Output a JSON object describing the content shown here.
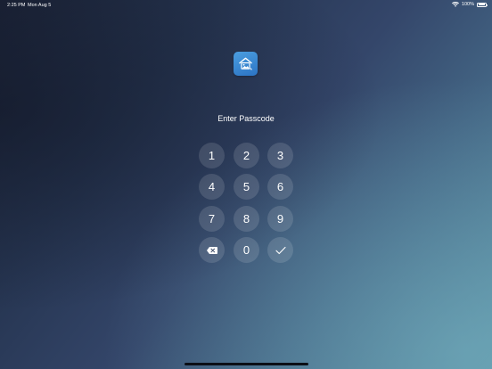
{
  "status_bar": {
    "time": "2:25 PM",
    "date": "Mon Aug 5",
    "battery_text": "100%",
    "wifi_icon": "wifi-icon",
    "battery_icon": "battery-icon",
    "battery_level": 1.0
  },
  "app": {
    "logo_icon": "home-photo-icon",
    "logo_color": "#3a8ad6"
  },
  "passcode": {
    "title": "Enter Passcode",
    "keys": [
      "1",
      "2",
      "3",
      "4",
      "5",
      "6",
      "7",
      "8",
      "9",
      "0"
    ],
    "delete_icon": "backspace-icon",
    "confirm_icon": "checkmark-icon"
  },
  "colors": {
    "background_dark": "#1c2438",
    "background_light": "#5a8fa3",
    "text": "#ffffff"
  }
}
